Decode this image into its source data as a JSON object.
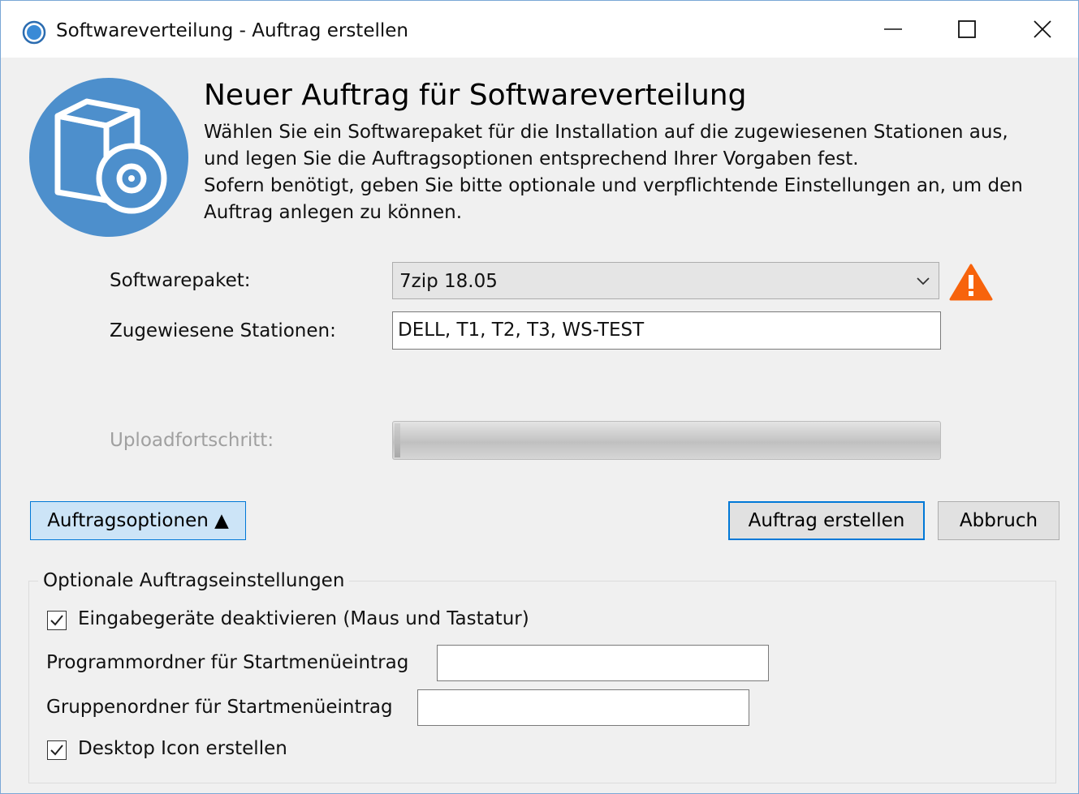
{
  "window": {
    "title": "Softwareverteilung - Auftrag erstellen",
    "icon": "circle-app-icon",
    "controls": [
      "minimize-icon",
      "maximize-icon",
      "close-icon"
    ]
  },
  "header": {
    "icon": "software-package-disc-icon",
    "title": "Neuer Auftrag für Softwareverteilung",
    "description": [
      "Wählen Sie ein Softwarepaket für die Installation auf die zugewiesenen Stationen aus,",
      "und legen Sie die Auftragsoptionen entsprechend Ihrer Vorgaben fest.",
      "Sofern benötigt, geben Sie bitte optionale und verpflichtende Einstellungen an, um den",
      "Auftrag anlegen zu können."
    ]
  },
  "form": {
    "package_label": "Softwarepaket:",
    "package_value": "7zip 18.05",
    "package_warning_icon": "warning-triangle-icon",
    "stations_label": "Zugewiesene Stationen:",
    "stations_value": "DELL, T1, T2, T3, WS-TEST",
    "upload_label": "Uploadfortschritt:",
    "upload_progress": 0.01
  },
  "buttons": {
    "options": "Auftragsoptionen ▲",
    "create": "Auftrag erstellen",
    "cancel": "Abbruch"
  },
  "options_group": {
    "title": "Optionale Auftragseinstellungen",
    "disable_input_label": "Eingabegeräte deaktivieren (Maus und Tastatur)",
    "disable_input_checked": true,
    "program_folder_label": "Programmordner für Startmenüeintrag",
    "program_folder_value": "",
    "group_folder_label": "Gruppenordner für Startmenüeintrag",
    "group_folder_value": "",
    "desktop_icon_label": "Desktop Icon erstellen",
    "desktop_icon_checked": true
  },
  "colors": {
    "accent": "#0078d7",
    "hero_circle": "#4d8fcc",
    "warning": "#f7630c",
    "window_bg": "#f0f0f0"
  }
}
